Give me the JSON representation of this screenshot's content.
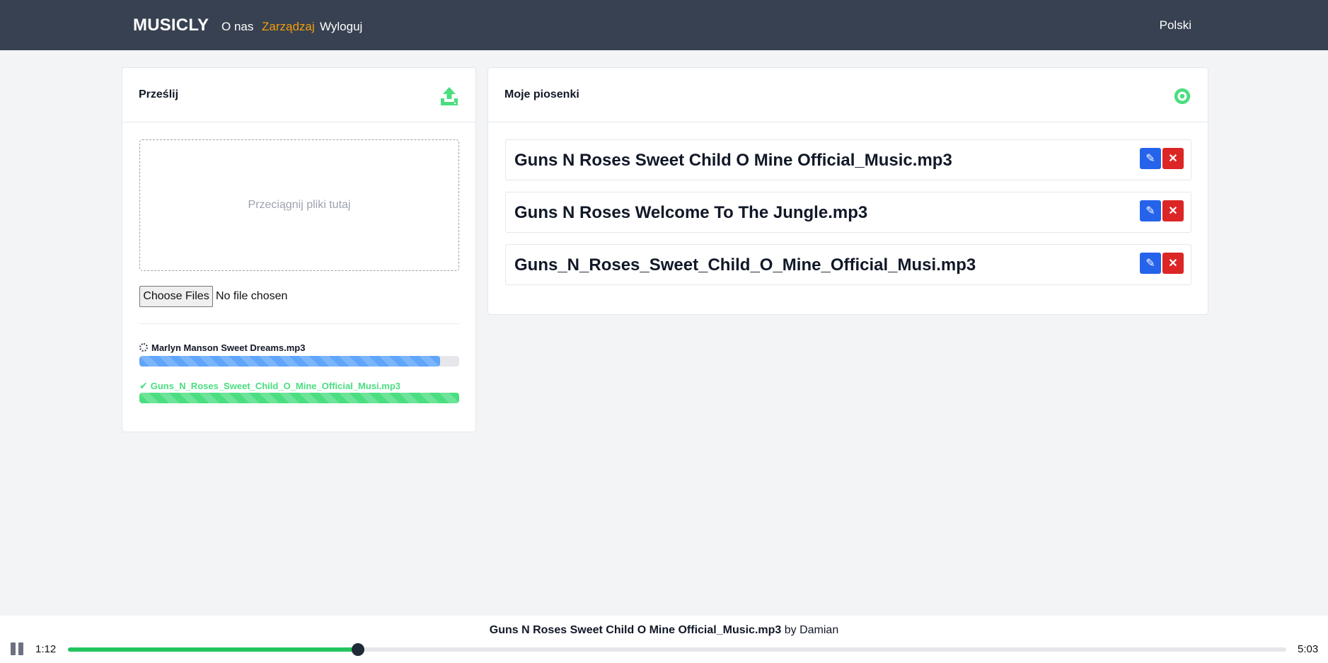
{
  "nav": {
    "brand": "MUSICLY",
    "links": [
      "O nas",
      "Zarządzaj",
      "Wyloguj"
    ],
    "active": "Zarządzaj",
    "language": "Polski"
  },
  "upload": {
    "title": "Prześlij",
    "icon": "upload-icon",
    "dropzone_text": "Przeciągnij pliki tutaj",
    "file_button": "Choose Files",
    "file_status": "No file chosen",
    "items": [
      {
        "name": "Marlyn Manson Sweet Dreams.mp3",
        "status": "uploading",
        "progress": 0.94
      },
      {
        "name": "Guns_N_Roses_Sweet_Child_O_Mine_Official_Musi.mp3",
        "status": "done",
        "progress": 1.0
      }
    ]
  },
  "songs": {
    "title": "Moje piosenki",
    "icon": "disc-icon",
    "list": [
      "Guns N Roses Sweet Child O Mine Official_Music.mp3",
      "Guns N Roses Welcome To The Jungle.mp3",
      "Guns_N_Roses_Sweet_Child_O_Mine_Official_Musi.mp3"
    ]
  },
  "player": {
    "title": "Guns N Roses Sweet Child O Mine Official_Music.mp3",
    "by": "by Damian",
    "current_time": "1:12",
    "total_time": "5:03",
    "progress": 0.238
  },
  "colors": {
    "navbar": "#374151",
    "accent_active": "#f59e0b",
    "green": "#4ade80",
    "edit": "#2563eb",
    "delete": "#dc2626"
  }
}
